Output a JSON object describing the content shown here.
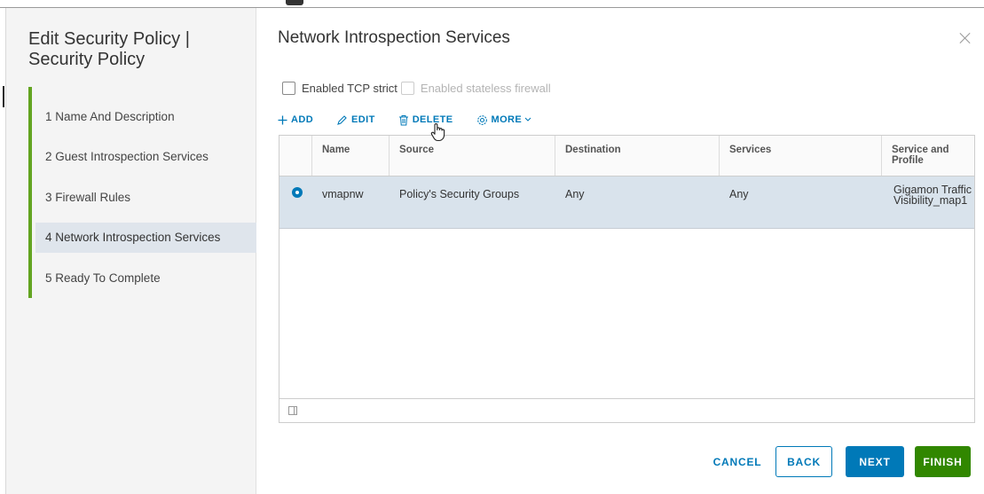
{
  "wizard": {
    "title": "Edit Security Policy | Security Policy",
    "steps": [
      {
        "label": "1 Name And Description",
        "active": false
      },
      {
        "label": "2 Guest Introspection Services",
        "active": false
      },
      {
        "label": "3 Firewall Rules",
        "active": false
      },
      {
        "label": "4 Network Introspection Services",
        "active": true
      },
      {
        "label": "5 Ready To Complete",
        "active": false
      }
    ],
    "step_accent_color": "#62a420"
  },
  "main": {
    "title": "Network Introspection Services",
    "close_icon": "close-icon",
    "options": {
      "tcp_strict": {
        "label": "Enabled TCP strict",
        "checked": false,
        "disabled": false
      },
      "stateless_firewall": {
        "label": "Enabled stateless firewall",
        "checked": false,
        "disabled": true
      }
    },
    "actions": {
      "add": {
        "label": "ADD",
        "icon": "plus-icon"
      },
      "edit": {
        "label": "EDIT",
        "icon": "pencil-icon"
      },
      "delete": {
        "label": "DELETE",
        "icon": "trash-icon"
      },
      "more": {
        "label": "MORE",
        "icon": "gear-icon"
      }
    },
    "table": {
      "headers": [
        "Name",
        "Source",
        "Destination",
        "Services",
        "Service and Profile"
      ],
      "rows": [
        {
          "selected": true,
          "name": "vmapnw",
          "source": "Policy's Security Groups",
          "destination": "Any",
          "services": "Any",
          "service_profile": "Gigamon Traffic Visibility_map1"
        }
      ],
      "selected_row_color": "#d9e3ec"
    }
  },
  "footer": {
    "cancel": "CANCEL",
    "back": "BACK",
    "next": "NEXT",
    "finish": "FINISH"
  },
  "colors": {
    "primary": "#0079b8",
    "success": "#318700"
  }
}
